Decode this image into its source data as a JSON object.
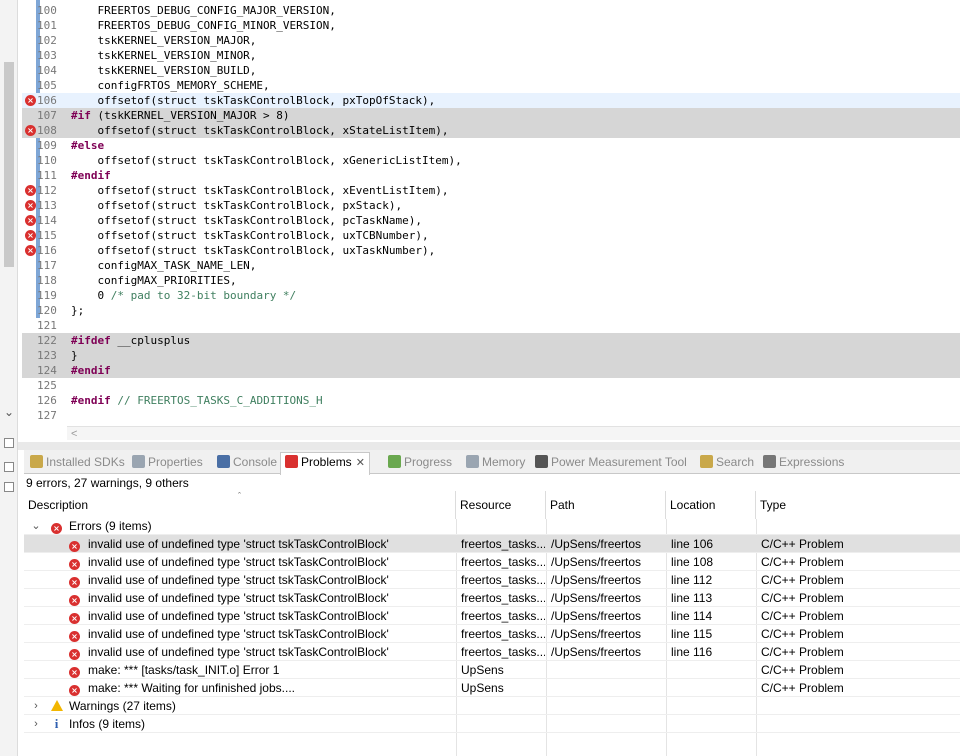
{
  "editor": {
    "lines": [
      {
        "num": "100",
        "text": "    FREERTOS_DEBUG_CONFIG_MAJOR_VERSION,"
      },
      {
        "num": "101",
        "text": "    FREERTOS_DEBUG_CONFIG_MINOR_VERSION,"
      },
      {
        "num": "102",
        "text": "    tskKERNEL_VERSION_MAJOR,"
      },
      {
        "num": "103",
        "text": "    tskKERNEL_VERSION_MINOR,"
      },
      {
        "num": "104",
        "text": "    tskKERNEL_VERSION_BUILD,"
      },
      {
        "num": "105",
        "text": "    configFRTOS_MEMORY_SCHEME,"
      },
      {
        "num": "106",
        "text": "    offsetof(struct tskTaskControlBlock, pxTopOfStack),"
      },
      {
        "num": "107",
        "kw": "#if",
        "text": " (tskKERNEL_VERSION_MAJOR > 8)"
      },
      {
        "num": "108",
        "text": "    offsetof(struct tskTaskControlBlock, xStateListItem),"
      },
      {
        "num": "109",
        "kw": "#else",
        "text": ""
      },
      {
        "num": "110",
        "text": "    offsetof(struct tskTaskControlBlock, xGenericListItem),"
      },
      {
        "num": "111",
        "kw": "#endif",
        "text": ""
      },
      {
        "num": "112",
        "text": "    offsetof(struct tskTaskControlBlock, xEventListItem),"
      },
      {
        "num": "113",
        "text": "    offsetof(struct tskTaskControlBlock, pxStack),"
      },
      {
        "num": "114",
        "text": "    offsetof(struct tskTaskControlBlock, pcTaskName),"
      },
      {
        "num": "115",
        "text": "    offsetof(struct tskTaskControlBlock, uxTCBNumber),"
      },
      {
        "num": "116",
        "text": "    offsetof(struct tskTaskControlBlock, uxTaskNumber),"
      },
      {
        "num": "117",
        "text": "    configMAX_TASK_NAME_LEN,"
      },
      {
        "num": "118",
        "text": "    configMAX_PRIORITIES,"
      },
      {
        "num": "119",
        "text": "    0 ",
        "comment": "/* pad to 32-bit boundary */"
      },
      {
        "num": "120",
        "text": "};"
      },
      {
        "num": "121",
        "text": ""
      },
      {
        "num": "122",
        "kw": "#ifdef",
        "text": " __cplusplus"
      },
      {
        "num": "123",
        "text": "}"
      },
      {
        "num": "124",
        "kw": "#endif",
        "text": ""
      },
      {
        "num": "125",
        "text": ""
      },
      {
        "num": "126",
        "kw": "#endif",
        "text": " ",
        "comment": "// FREERTOS_TASKS_C_ADDITIONS_H"
      },
      {
        "num": "127",
        "text": ""
      }
    ],
    "hscroll_left": "<"
  },
  "tabs": [
    {
      "label": "Installed SDKs",
      "icon": "sdk-icon",
      "color": "#c9a84a"
    },
    {
      "label": "Properties",
      "icon": "properties-icon",
      "color": "#9aa5b1"
    },
    {
      "label": "Console",
      "icon": "console-icon",
      "color": "#4a6fa5"
    },
    {
      "label": "Problems",
      "icon": "problems-icon",
      "color": "#d9302f"
    },
    {
      "label": "Progress",
      "icon": "progress-icon",
      "color": "#6aa84f"
    },
    {
      "label": "Memory",
      "icon": "memory-icon",
      "color": "#9aa5b1"
    },
    {
      "label": "Power Measurement Tool",
      "icon": "power-icon",
      "color": "#555555"
    },
    {
      "label": "Search",
      "icon": "search-icon",
      "color": "#c9a84a"
    },
    {
      "label": "Expressions",
      "icon": "expressions-icon",
      "color": "#777777"
    }
  ],
  "problems": {
    "summary": "9 errors, 27 warnings, 9 others",
    "columns": [
      "Description",
      "Resource",
      "Path",
      "Location",
      "Type"
    ],
    "errors_group": "Errors (9 items)",
    "warnings_group": "Warnings (27 items)",
    "infos_group": "Infos (9 items)",
    "rows": [
      {
        "desc": "invalid use of undefined type 'struct tskTaskControlBlock'",
        "resource": "freertos_tasks...",
        "path": "/UpSens/freertos",
        "location": "line 106",
        "type": "C/C++ Problem"
      },
      {
        "desc": "invalid use of undefined type 'struct tskTaskControlBlock'",
        "resource": "freertos_tasks...",
        "path": "/UpSens/freertos",
        "location": "line 108",
        "type": "C/C++ Problem"
      },
      {
        "desc": "invalid use of undefined type 'struct tskTaskControlBlock'",
        "resource": "freertos_tasks...",
        "path": "/UpSens/freertos",
        "location": "line 112",
        "type": "C/C++ Problem"
      },
      {
        "desc": "invalid use of undefined type 'struct tskTaskControlBlock'",
        "resource": "freertos_tasks...",
        "path": "/UpSens/freertos",
        "location": "line 113",
        "type": "C/C++ Problem"
      },
      {
        "desc": "invalid use of undefined type 'struct tskTaskControlBlock'",
        "resource": "freertos_tasks...",
        "path": "/UpSens/freertos",
        "location": "line 114",
        "type": "C/C++ Problem"
      },
      {
        "desc": "invalid use of undefined type 'struct tskTaskControlBlock'",
        "resource": "freertos_tasks...",
        "path": "/UpSens/freertos",
        "location": "line 115",
        "type": "C/C++ Problem"
      },
      {
        "desc": "invalid use of undefined type 'struct tskTaskControlBlock'",
        "resource": "freertos_tasks...",
        "path": "/UpSens/freertos",
        "location": "line 116",
        "type": "C/C++ Problem"
      },
      {
        "desc": "make: *** [tasks/task_INIT.o] Error 1",
        "resource": "UpSens",
        "path": "",
        "location": "",
        "type": "C/C++ Problem"
      },
      {
        "desc": "make: *** Waiting for unfinished jobs....",
        "resource": "UpSens",
        "path": "",
        "location": "",
        "type": "C/C++ Problem"
      }
    ]
  }
}
